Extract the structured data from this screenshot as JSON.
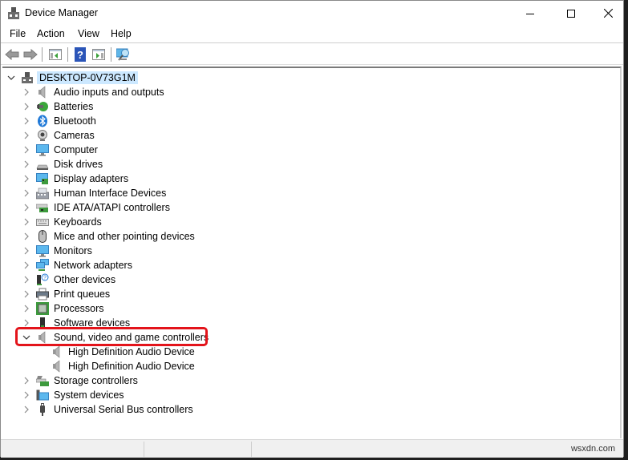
{
  "window": {
    "title": "Device Manager",
    "controls": {
      "minimize": "minimize",
      "maximize": "maximize",
      "close": "close"
    }
  },
  "menu": [
    "File",
    "Action",
    "View",
    "Help"
  ],
  "toolbar": {
    "buttons": [
      "back-icon",
      "forward-icon",
      "show-hide-console-tree-icon",
      "help-icon",
      "show-hide-action-pane-icon",
      "scan-hardware-icon"
    ]
  },
  "tree": {
    "root": "DESKTOP-0V73G1M",
    "categories": [
      {
        "label": "Audio inputs and outputs",
        "icon": "speaker-icon",
        "expanded": false
      },
      {
        "label": "Batteries",
        "icon": "battery-icon",
        "expanded": false
      },
      {
        "label": "Bluetooth",
        "icon": "bluetooth-icon",
        "expanded": false
      },
      {
        "label": "Cameras",
        "icon": "camera-icon",
        "expanded": false
      },
      {
        "label": "Computer",
        "icon": "computer-icon",
        "expanded": false
      },
      {
        "label": "Disk drives",
        "icon": "disk-drive-icon",
        "expanded": false
      },
      {
        "label": "Display adapters",
        "icon": "display-adapter-icon",
        "expanded": false
      },
      {
        "label": "Human Interface Devices",
        "icon": "hid-icon",
        "expanded": false
      },
      {
        "label": "IDE ATA/ATAPI controllers",
        "icon": "ide-controller-icon",
        "expanded": false
      },
      {
        "label": "Keyboards",
        "icon": "keyboard-icon",
        "expanded": false
      },
      {
        "label": "Mice and other pointing devices",
        "icon": "mouse-icon",
        "expanded": false
      },
      {
        "label": "Monitors",
        "icon": "monitor-icon",
        "expanded": false
      },
      {
        "label": "Network adapters",
        "icon": "network-adapter-icon",
        "expanded": false
      },
      {
        "label": "Other devices",
        "icon": "other-devices-icon",
        "expanded": false
      },
      {
        "label": "Print queues",
        "icon": "printer-icon",
        "expanded": false
      },
      {
        "label": "Processors",
        "icon": "processor-icon",
        "expanded": false
      },
      {
        "label": "Software devices",
        "icon": "software-device-icon",
        "expanded": false
      },
      {
        "label": "Sound, video and game controllers",
        "icon": "speaker-icon",
        "expanded": true,
        "highlighted": true,
        "children": [
          "High Definition Audio Device",
          "High Definition Audio Device"
        ]
      },
      {
        "label": "Storage controllers",
        "icon": "storage-controller-icon",
        "expanded": false
      },
      {
        "label": "System devices",
        "icon": "system-devices-icon",
        "expanded": false
      },
      {
        "label": "Universal Serial Bus controllers",
        "icon": "usb-icon",
        "expanded": false
      }
    ]
  },
  "status": {
    "watermark": "wsxdn.com"
  },
  "colors": {
    "selection": "#cce8ff",
    "highlight_box": "#e3141b",
    "accent_blue": "#1e78d7"
  }
}
